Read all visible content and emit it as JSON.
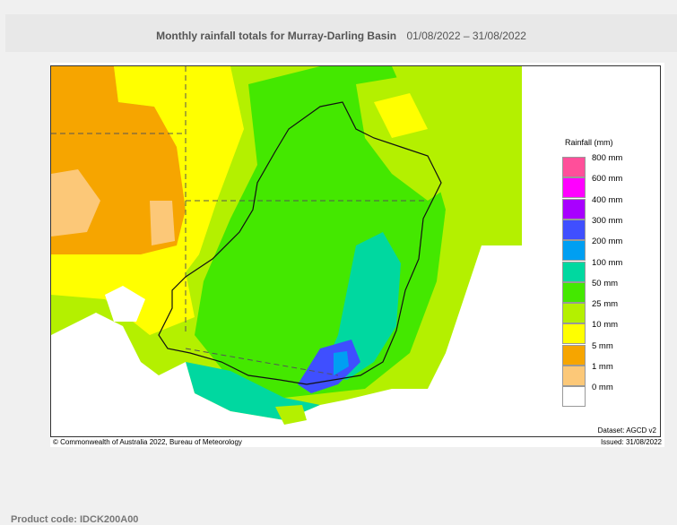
{
  "header": {
    "title": "Monthly rainfall totals for Murray-Darling Basin",
    "date_range": "01/08/2022 – 31/08/2022"
  },
  "map": {
    "legend": {
      "title": "Rainfall (mm)",
      "items": [
        {
          "label": "800 mm",
          "color": "#ff4f9a"
        },
        {
          "label": "600 mm",
          "color": "#ff00ff"
        },
        {
          "label": "400 mm",
          "color": "#a800ff"
        },
        {
          "label": "300 mm",
          "color": "#3f4fff"
        },
        {
          "label": "200 mm",
          "color": "#009ff2"
        },
        {
          "label": "100 mm",
          "color": "#00d8a0"
        },
        {
          "label": "50 mm",
          "color": "#44e800"
        },
        {
          "label": "25 mm",
          "color": "#b4f000"
        },
        {
          "label": "10 mm",
          "color": "#ffff00"
        },
        {
          "label": "5 mm",
          "color": "#f6a500"
        },
        {
          "label": "1 mm",
          "color": "#fcc878"
        },
        {
          "label": "0 mm",
          "color": "#ffffff"
        }
      ]
    },
    "dataset": "Dataset: AGCD v2",
    "copyright": "© Commonwealth of Australia 2022, Bureau of Meteorology",
    "issued": "Issued: 31/08/2022"
  },
  "footer": {
    "product_code": "Product code: IDCK200A00"
  }
}
